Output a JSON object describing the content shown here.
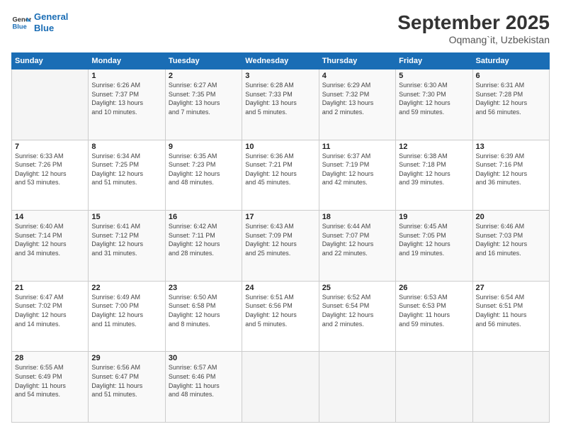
{
  "header": {
    "logo_line1": "General",
    "logo_line2": "Blue",
    "month": "September 2025",
    "location": "Oqmang`it, Uzbekistan"
  },
  "weekdays": [
    "Sunday",
    "Monday",
    "Tuesday",
    "Wednesday",
    "Thursday",
    "Friday",
    "Saturday"
  ],
  "weeks": [
    [
      {
        "day": "",
        "info": ""
      },
      {
        "day": "1",
        "info": "Sunrise: 6:26 AM\nSunset: 7:37 PM\nDaylight: 13 hours\nand 10 minutes."
      },
      {
        "day": "2",
        "info": "Sunrise: 6:27 AM\nSunset: 7:35 PM\nDaylight: 13 hours\nand 7 minutes."
      },
      {
        "day": "3",
        "info": "Sunrise: 6:28 AM\nSunset: 7:33 PM\nDaylight: 13 hours\nand 5 minutes."
      },
      {
        "day": "4",
        "info": "Sunrise: 6:29 AM\nSunset: 7:32 PM\nDaylight: 13 hours\nand 2 minutes."
      },
      {
        "day": "5",
        "info": "Sunrise: 6:30 AM\nSunset: 7:30 PM\nDaylight: 12 hours\nand 59 minutes."
      },
      {
        "day": "6",
        "info": "Sunrise: 6:31 AM\nSunset: 7:28 PM\nDaylight: 12 hours\nand 56 minutes."
      }
    ],
    [
      {
        "day": "7",
        "info": "Sunrise: 6:33 AM\nSunset: 7:26 PM\nDaylight: 12 hours\nand 53 minutes."
      },
      {
        "day": "8",
        "info": "Sunrise: 6:34 AM\nSunset: 7:25 PM\nDaylight: 12 hours\nand 51 minutes."
      },
      {
        "day": "9",
        "info": "Sunrise: 6:35 AM\nSunset: 7:23 PM\nDaylight: 12 hours\nand 48 minutes."
      },
      {
        "day": "10",
        "info": "Sunrise: 6:36 AM\nSunset: 7:21 PM\nDaylight: 12 hours\nand 45 minutes."
      },
      {
        "day": "11",
        "info": "Sunrise: 6:37 AM\nSunset: 7:19 PM\nDaylight: 12 hours\nand 42 minutes."
      },
      {
        "day": "12",
        "info": "Sunrise: 6:38 AM\nSunset: 7:18 PM\nDaylight: 12 hours\nand 39 minutes."
      },
      {
        "day": "13",
        "info": "Sunrise: 6:39 AM\nSunset: 7:16 PM\nDaylight: 12 hours\nand 36 minutes."
      }
    ],
    [
      {
        "day": "14",
        "info": "Sunrise: 6:40 AM\nSunset: 7:14 PM\nDaylight: 12 hours\nand 34 minutes."
      },
      {
        "day": "15",
        "info": "Sunrise: 6:41 AM\nSunset: 7:12 PM\nDaylight: 12 hours\nand 31 minutes."
      },
      {
        "day": "16",
        "info": "Sunrise: 6:42 AM\nSunset: 7:11 PM\nDaylight: 12 hours\nand 28 minutes."
      },
      {
        "day": "17",
        "info": "Sunrise: 6:43 AM\nSunset: 7:09 PM\nDaylight: 12 hours\nand 25 minutes."
      },
      {
        "day": "18",
        "info": "Sunrise: 6:44 AM\nSunset: 7:07 PM\nDaylight: 12 hours\nand 22 minutes."
      },
      {
        "day": "19",
        "info": "Sunrise: 6:45 AM\nSunset: 7:05 PM\nDaylight: 12 hours\nand 19 minutes."
      },
      {
        "day": "20",
        "info": "Sunrise: 6:46 AM\nSunset: 7:03 PM\nDaylight: 12 hours\nand 16 minutes."
      }
    ],
    [
      {
        "day": "21",
        "info": "Sunrise: 6:47 AM\nSunset: 7:02 PM\nDaylight: 12 hours\nand 14 minutes."
      },
      {
        "day": "22",
        "info": "Sunrise: 6:49 AM\nSunset: 7:00 PM\nDaylight: 12 hours\nand 11 minutes."
      },
      {
        "day": "23",
        "info": "Sunrise: 6:50 AM\nSunset: 6:58 PM\nDaylight: 12 hours\nand 8 minutes."
      },
      {
        "day": "24",
        "info": "Sunrise: 6:51 AM\nSunset: 6:56 PM\nDaylight: 12 hours\nand 5 minutes."
      },
      {
        "day": "25",
        "info": "Sunrise: 6:52 AM\nSunset: 6:54 PM\nDaylight: 12 hours\nand 2 minutes."
      },
      {
        "day": "26",
        "info": "Sunrise: 6:53 AM\nSunset: 6:53 PM\nDaylight: 11 hours\nand 59 minutes."
      },
      {
        "day": "27",
        "info": "Sunrise: 6:54 AM\nSunset: 6:51 PM\nDaylight: 11 hours\nand 56 minutes."
      }
    ],
    [
      {
        "day": "28",
        "info": "Sunrise: 6:55 AM\nSunset: 6:49 PM\nDaylight: 11 hours\nand 54 minutes."
      },
      {
        "day": "29",
        "info": "Sunrise: 6:56 AM\nSunset: 6:47 PM\nDaylight: 11 hours\nand 51 minutes."
      },
      {
        "day": "30",
        "info": "Sunrise: 6:57 AM\nSunset: 6:46 PM\nDaylight: 11 hours\nand 48 minutes."
      },
      {
        "day": "",
        "info": ""
      },
      {
        "day": "",
        "info": ""
      },
      {
        "day": "",
        "info": ""
      },
      {
        "day": "",
        "info": ""
      }
    ]
  ]
}
